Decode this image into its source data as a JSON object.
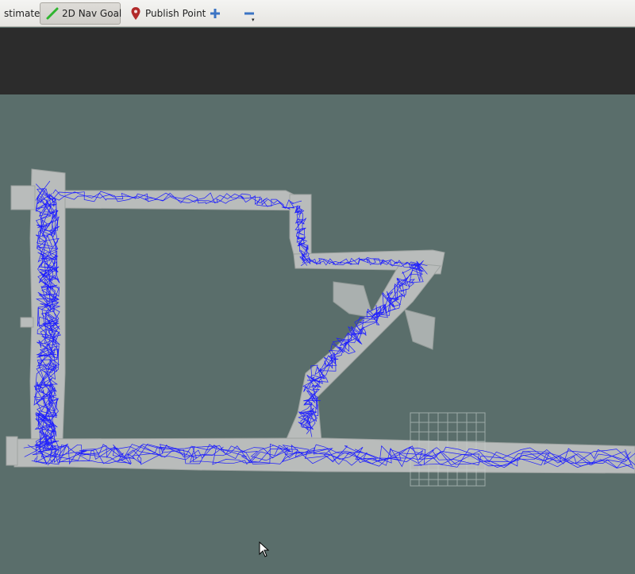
{
  "toolbar": {
    "tools": [
      {
        "label": "stimate",
        "icon": "pose-estimate-icon"
      },
      {
        "label": "2D Nav Goal",
        "icon": "nav-goal-arrow-icon",
        "active": true
      },
      {
        "label": "Publish Point",
        "icon": "map-pin-icon",
        "icon_color": "#b22a2a"
      },
      {
        "label": "",
        "icon": "zoom-in-plus-icon",
        "icon_color": "#3b74c4"
      },
      {
        "label": "",
        "icon": "zoom-out-minus-icon",
        "icon_color": "#3b74c4"
      }
    ]
  },
  "map": {
    "background_color": "#5a6e6b",
    "free_space_color": "#b9bcbb",
    "trajectory_color": "#1c1cff",
    "grid_color": "#c9d2d0"
  }
}
